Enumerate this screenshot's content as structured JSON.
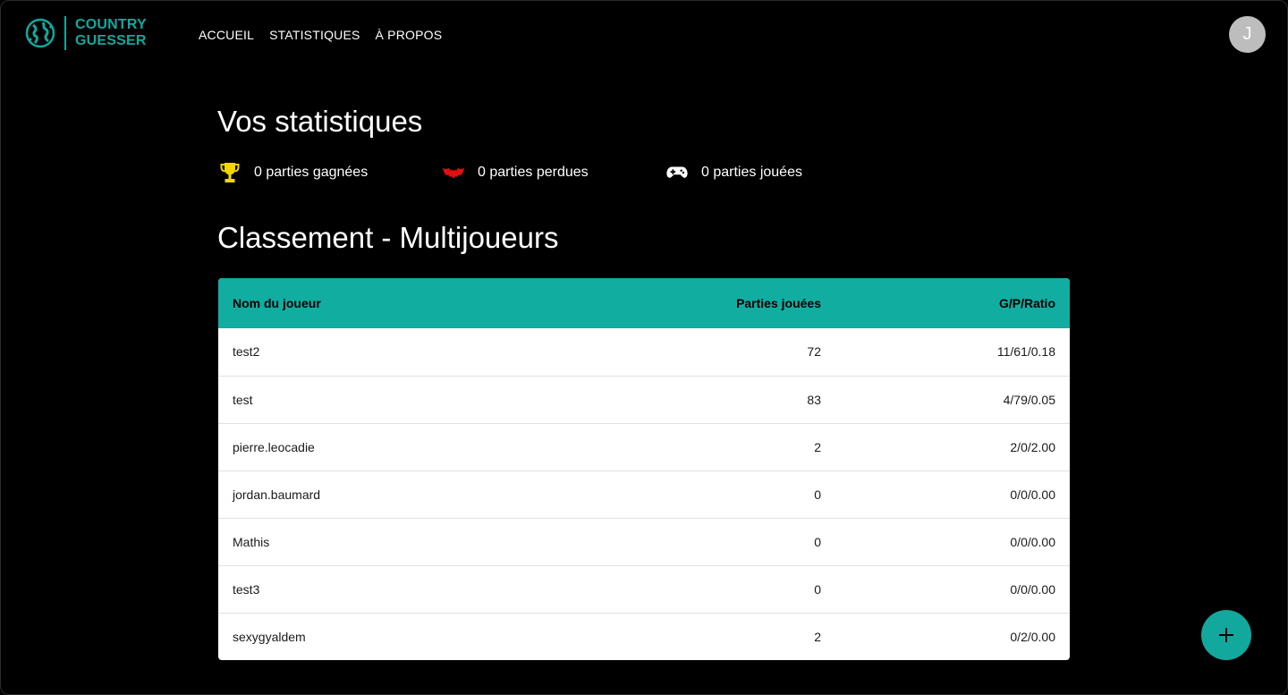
{
  "brand": {
    "line1": "COUNTRY",
    "line2": "GUESSER",
    "color": "#12a89d"
  },
  "nav": {
    "items": [
      {
        "label": "ACCUEIL"
      },
      {
        "label": "STATISTIQUES"
      },
      {
        "label": "À PROPOS"
      }
    ]
  },
  "user": {
    "avatar_initial": "J"
  },
  "stats": {
    "title": "Vos statistiques",
    "won": {
      "text": "0 parties gagnées",
      "icon": "trophy-icon"
    },
    "lost": {
      "text": "0 parties perdues",
      "icon": "bat-icon"
    },
    "played": {
      "text": "0 parties jouées",
      "icon": "gamepad-icon"
    }
  },
  "ranking": {
    "title": "Classement - Multijoueurs",
    "columns": {
      "name": "Nom du joueur",
      "played": "Parties jouées",
      "ratio": "G/P/Ratio"
    },
    "rows": [
      {
        "name": "test2",
        "played": "72",
        "ratio": "11/61/0.18"
      },
      {
        "name": "test",
        "played": "83",
        "ratio": "4/79/0.05"
      },
      {
        "name": "pierre.leocadie",
        "played": "2",
        "ratio": "2/0/2.00"
      },
      {
        "name": "jordan.baumard",
        "played": "0",
        "ratio": "0/0/0.00"
      },
      {
        "name": "Mathis",
        "played": "0",
        "ratio": "0/0/0.00"
      },
      {
        "name": "test3",
        "played": "0",
        "ratio": "0/0/0.00"
      },
      {
        "name": "sexygyaldem",
        "played": "2",
        "ratio": "0/2/0.00"
      }
    ]
  },
  "fab": {
    "icon": "plus-icon"
  },
  "colors": {
    "accent": "#12ada1",
    "background": "#000000",
    "trophy": "#f2d600",
    "lost": "#e01010"
  }
}
